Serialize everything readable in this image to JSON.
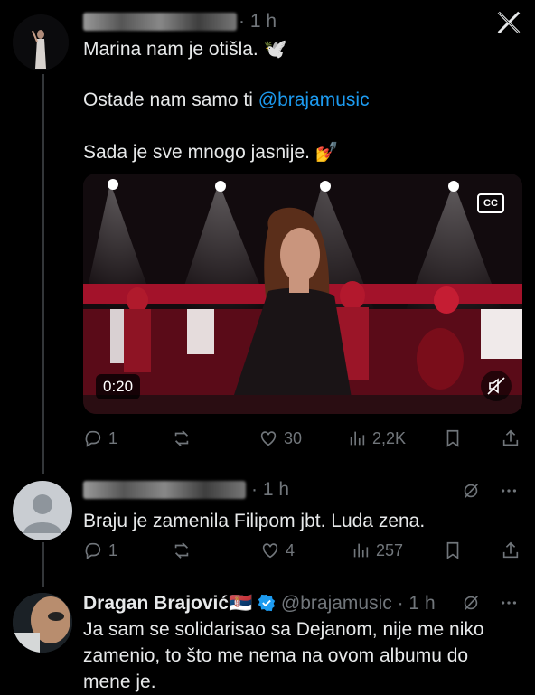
{
  "tweets": [
    {
      "time": "· 1 h",
      "lines": [
        "Marina nam je otišla. 🕊️",
        "Ostade nam samo ti ",
        "Sada je sve mnogo jasnije. 💅"
      ],
      "mention": "@brajamusic",
      "video": {
        "duration": "0:20",
        "cc_label": "CC"
      },
      "stats": {
        "replies": "1",
        "retweets": "",
        "likes": "30",
        "views": "2,2K"
      }
    },
    {
      "time": "· 1 h",
      "text": "Braju je zamenila Filipom jbt. Luda zena.",
      "stats": {
        "replies": "1",
        "retweets": "",
        "likes": "4",
        "views": "257"
      }
    },
    {
      "name": "Dragan Brajović🇷🇸",
      "handle": "@brajamusic",
      "time": "· 1 h",
      "text": "Ja sam se solidarisao sa Dejanom, nije me niko zamenio, to što me nema na ovom albumu do mene je."
    }
  ],
  "icons": [
    "close-x-icon",
    "reply-icon",
    "retweet-icon",
    "like-icon",
    "views-icon",
    "bookmark-icon",
    "share-icon",
    "grok-icon",
    "more-icon",
    "verified-icon",
    "mute-icon"
  ]
}
